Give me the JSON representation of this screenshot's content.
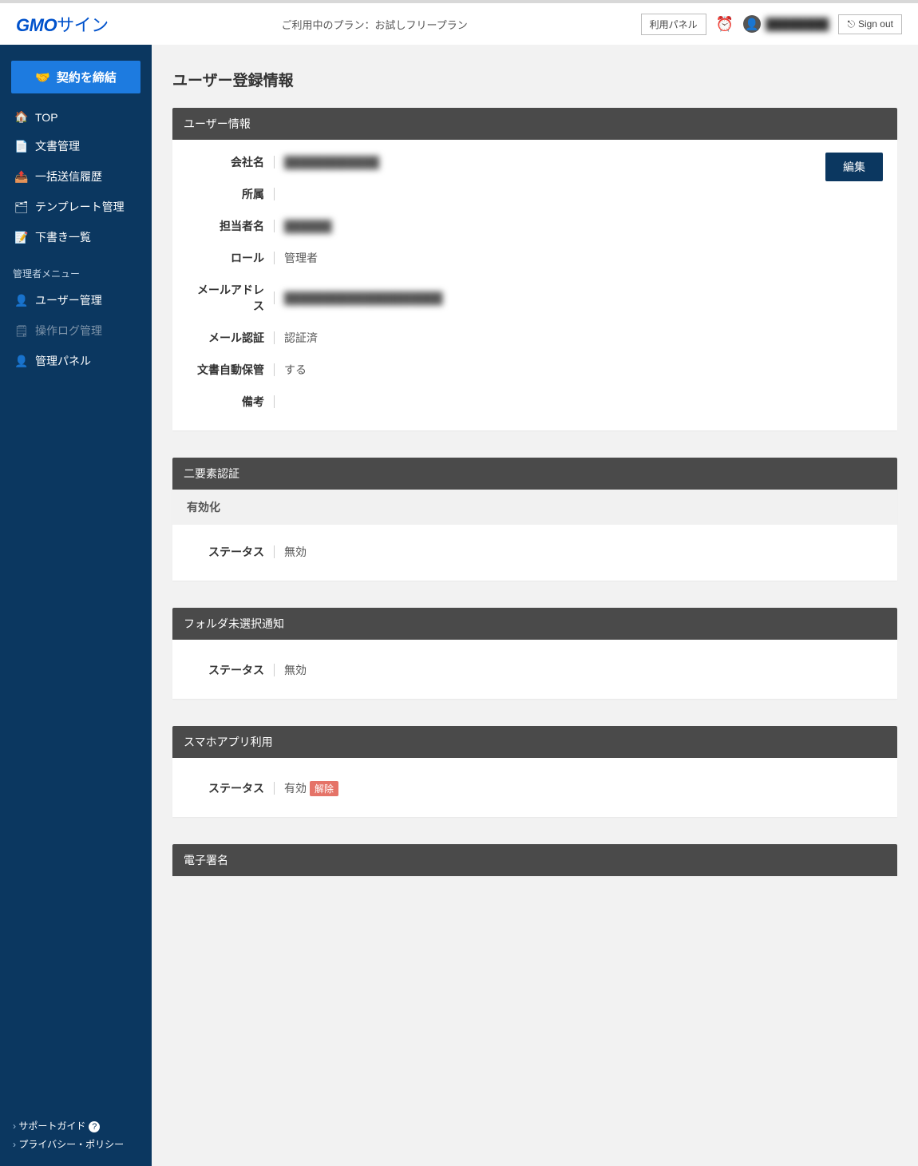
{
  "header": {
    "logo_bold": "GMO",
    "logo_rest": "サイン",
    "plan_prefix": "ご利用中のプラン：",
    "plan_name": "お試しフリープラン",
    "panel_btn": "利用パネル",
    "account_name": "████████",
    "signout": "Sign out"
  },
  "sidebar": {
    "contract_btn": "契約を締結",
    "items": [
      {
        "icon": "🏠",
        "label": "TOP"
      },
      {
        "icon": "📄",
        "label": "文書管理"
      },
      {
        "icon": "📤",
        "label": "一括送信履歴"
      },
      {
        "icon": "🗂",
        "label": "テンプレート管理"
      },
      {
        "icon": "📝",
        "label": "下書き一覧"
      }
    ],
    "admin_label": "管理者メニュー",
    "admin_items": [
      {
        "icon": "👤",
        "label": "ユーザー管理",
        "dim": false
      },
      {
        "icon": "🗒",
        "label": "操作ログ管理",
        "dim": true
      },
      {
        "icon": "👤",
        "label": "管理パネル",
        "dim": false
      }
    ],
    "footer": [
      "サポートガイド",
      "プライバシー・ポリシー"
    ]
  },
  "page": {
    "title": "ユーザー登録情報"
  },
  "user_info": {
    "header": "ユーザー情報",
    "edit": "編集",
    "rows": [
      {
        "label": "会社名",
        "value": "████████████",
        "blur": true
      },
      {
        "label": "所属",
        "value": ""
      },
      {
        "label": "担当者名",
        "value": "██████",
        "blur": true
      },
      {
        "label": "ロール",
        "value": "管理者"
      },
      {
        "label": "メールアドレス",
        "value": "████████████████████",
        "blur": true
      },
      {
        "label": "メール認証",
        "value": "認証済"
      },
      {
        "label": "文書自動保管",
        "value": "する"
      },
      {
        "label": "備考",
        "value": ""
      }
    ]
  },
  "twofa": {
    "header": "二要素認証",
    "sub": "有効化",
    "status_label": "ステータス",
    "status_value": "無効"
  },
  "folder_notify": {
    "header": "フォルダ未選択通知",
    "status_label": "ステータス",
    "status_value": "無効"
  },
  "app_use": {
    "header": "スマホアプリ利用",
    "status_label": "ステータス",
    "status_value": "有効",
    "tag": "解除"
  },
  "esign": {
    "header": "電子署名"
  }
}
